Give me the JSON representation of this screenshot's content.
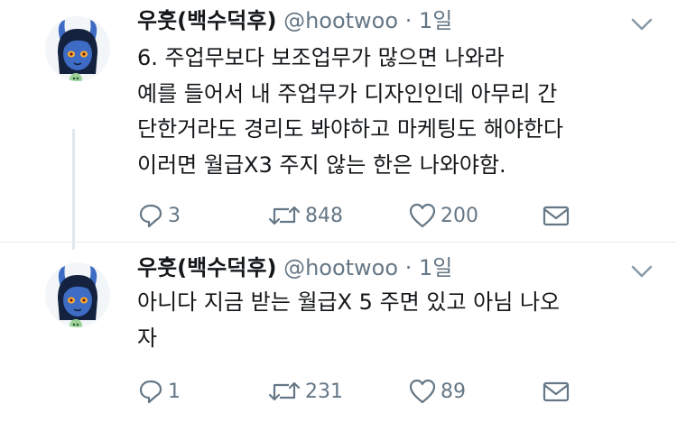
{
  "tweets": [
    {
      "author_name": "우훗(백수덕후)",
      "handle": "@hootwoo",
      "separator": "·",
      "time": "1일",
      "lines": [
        "6. 주업무보다 보조업무가 많으면 나와라",
        "예를 들어서 내 주업무가 디자인인데 아무리 간",
        "단한거라도 경리도 봐야하고 마케팅도 해야한다",
        "이러면 월급X3 주지 않는 한은 나와야함."
      ],
      "replies": "3",
      "retweets": "848",
      "likes": "200"
    },
    {
      "author_name": "우훗(백수덕후)",
      "handle": "@hootwoo",
      "separator": "·",
      "time": "1일",
      "lines": [
        "아니다 지금 받는 월급X 5 주면 있고 아님 나오",
        "자"
      ],
      "replies": "1",
      "retweets": "231",
      "likes": "89"
    }
  ],
  "icons": {
    "reply": "reply-icon",
    "retweet": "retweet-icon",
    "like": "heart-icon",
    "message": "envelope-icon",
    "more": "chevron-down-icon"
  },
  "colors": {
    "text": "#14171a",
    "secondary": "#657786",
    "avatar_skin": "#3e6cc4",
    "avatar_hair": "#14213f",
    "thread_line": "#e1e8ed"
  }
}
